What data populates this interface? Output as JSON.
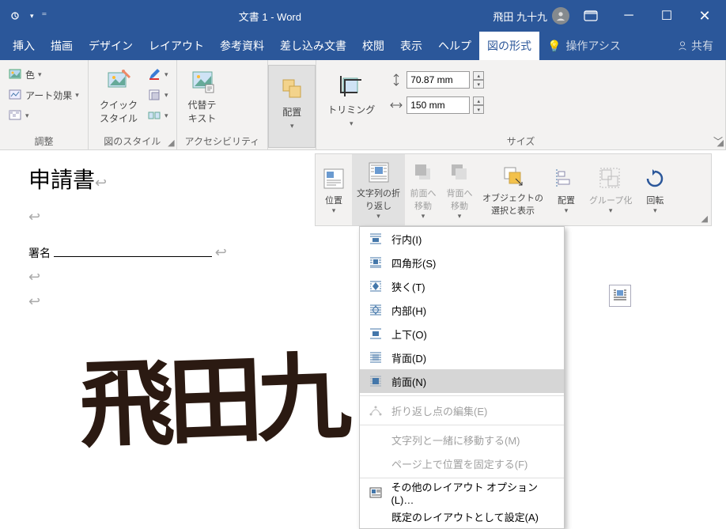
{
  "titlebar": {
    "title": "文書 1  -  Word",
    "user": "飛田 九十九"
  },
  "tabs": {
    "insert": "挿入",
    "draw": "描画",
    "design": "デザイン",
    "layout": "レイアウト",
    "references": "参考資料",
    "mailings": "差し込み文書",
    "review": "校閲",
    "view": "表示",
    "help": "ヘルプ",
    "picture_format": "図の形式",
    "tell_me": "操作アシス",
    "share": "共有"
  },
  "ribbon": {
    "adjust": {
      "color": "色",
      "artistic": "アート効果",
      "label": "調整"
    },
    "styles": {
      "quick": "クイック\nスタイル",
      "label": "図のスタイル"
    },
    "accessibility": {
      "alt": "代替テ\nキスト",
      "label": "アクセシビリティ"
    },
    "arrange": {
      "arrange": "配置",
      "label": ""
    },
    "size": {
      "crop": "トリミング",
      "h": "70.87 mm",
      "w": "150 mm",
      "label": "サイズ"
    }
  },
  "gallery": {
    "position": "位置",
    "wrap": "文字列の折\nり返し",
    "bring_fwd": "前面へ\n移動",
    "send_back": "背面へ\n移動",
    "selection": "オブジェクトの\n選択と表示",
    "align": "配置",
    "group": "グループ化",
    "rotate": "回転"
  },
  "menu": {
    "inline": "行内(I)",
    "square": "四角形(S)",
    "tight": "狭く(T)",
    "through": "内部(H)",
    "topbottom": "上下(O)",
    "behind": "背面(D)",
    "front": "前面(N)",
    "edit_points": "折り返し点の編集(E)",
    "move_with_text": "文字列と一緒に移動する(M)",
    "fix_position": "ページ上で位置を固定する(F)",
    "more_layout": "その他のレイアウト オプション(L)…",
    "set_default": "既定のレイアウトとして設定(A)"
  },
  "document": {
    "heading": "申請書",
    "signature_label": "署名",
    "signature_image": "飛田九"
  }
}
